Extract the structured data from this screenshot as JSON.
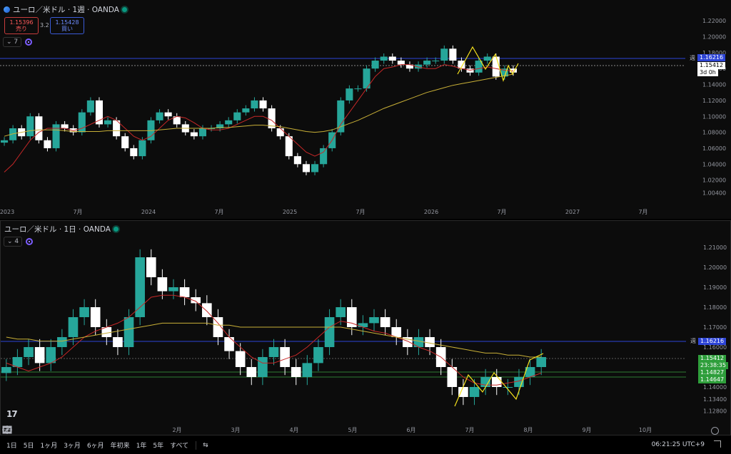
{
  "top_chart": {
    "title": "ユーロ／米ドル · 1週 · OANDA",
    "sell_price": "1.15396",
    "sell_label": "売り",
    "spread": "3.2",
    "buy_price": "1.15428",
    "buy_label": "買い",
    "indicator_count": "7",
    "y_ticks": [
      "1.22000",
      "1.20000",
      "1.18000",
      "1.16000",
      "1.14000",
      "1.12000",
      "1.10000",
      "1.08000",
      "1.06000",
      "1.04000",
      "1.02000",
      "1.00400"
    ],
    "x_ticks": [
      "2023",
      "7月",
      "2024",
      "7月",
      "2025",
      "7月",
      "2026",
      "7月",
      "2027",
      "7月"
    ],
    "line_label": "週",
    "line_price": "1.16216",
    "current_price": "1.15412",
    "countdown": "3d 0h"
  },
  "bottom_chart": {
    "title": "ユーロ／米ドル · 1日 · OANDA",
    "indicator_count": "4",
    "y_ticks": [
      "1.21000",
      "1.20000",
      "1.19000",
      "1.18000",
      "1.17000",
      "1.16000",
      "1.15000",
      "1.14000",
      "1.13400",
      "1.12800"
    ],
    "x_ticks": [
      "2月",
      "3月",
      "4月",
      "5月",
      "6月",
      "7月",
      "8月",
      "9月",
      "10月"
    ],
    "line_label": "週",
    "line_price": "1.16216",
    "current_price": "1.15412",
    "countdown": "23:38:35",
    "support_1": "1.14827",
    "support_2": "1.14647"
  },
  "toolbar": {
    "timeframes": [
      "1日",
      "5日",
      "1ヶ月",
      "3ヶ月",
      "6ヶ月",
      "年初来",
      "1年",
      "5年",
      "すべて"
    ],
    "clock": "06:21:25 UTC+9",
    "logo": "17"
  },
  "colors": {
    "up": "#26a69a",
    "down": "#ffffff",
    "ma_red": "#c62828",
    "ma_yellow": "#c9b037",
    "pattern": "#f5e11c",
    "blue_line": "#2d44d6",
    "green_line": "#2e7d32"
  },
  "chart_data": [
    {
      "type": "candlestick",
      "title": "ユーロ／米ドル · 1週 · OANDA",
      "x": [
        "2023",
        "7月",
        "2024",
        "7月",
        "2025",
        "7月",
        "2026",
        "7月",
        "2027",
        "7月"
      ],
      "ylim": [
        1.0,
        1.23
      ],
      "series": [
        {
          "values": [
            1.07,
            1.085,
            1.075,
            1.1,
            1.07,
            1.06,
            1.09,
            1.085,
            1.08,
            1.105,
            1.12,
            1.09,
            1.095,
            1.075,
            1.06,
            1.05,
            1.07,
            1.095,
            1.105,
            1.1,
            1.09,
            1.08,
            1.075,
            1.085,
            1.085,
            1.09,
            1.095,
            1.105,
            1.11,
            1.12,
            1.11,
            1.085,
            1.075,
            1.05,
            1.04,
            1.03,
            1.04,
            1.06,
            1.08,
            1.12,
            1.135,
            1.135,
            1.16,
            1.17,
            1.175,
            1.17,
            1.165,
            1.16,
            1.165,
            1.17,
            1.17,
            1.185,
            1.17,
            1.16,
            1.155,
            1.17,
            1.175,
            1.15,
            1.16,
            1.155
          ]
        },
        {
          "values": [
            1.03,
            1.04,
            1.055,
            1.07,
            1.08,
            1.085,
            1.085,
            1.085,
            1.082,
            1.085,
            1.09,
            1.095,
            1.1,
            1.095,
            1.085,
            1.075,
            1.07,
            1.075,
            1.085,
            1.095,
            1.1,
            1.098,
            1.092,
            1.085,
            1.083,
            1.083,
            1.085,
            1.09,
            1.095,
            1.1,
            1.1,
            1.095,
            1.085,
            1.075,
            1.065,
            1.055,
            1.05,
            1.055,
            1.07,
            1.09,
            1.105,
            1.12,
            1.135,
            1.15,
            1.16,
            1.162,
            1.165,
            1.165,
            1.162,
            1.16,
            1.16,
            1.165,
            1.163,
            1.16,
            1.158,
            1.16,
            1.162,
            1.16,
            1.158,
            1.157
          ]
        },
        {
          "values": [
            1.075,
            1.078,
            1.08,
            1.082,
            1.083,
            1.083,
            1.083,
            1.082,
            1.081,
            1.081,
            1.081,
            1.081,
            1.082,
            1.082,
            1.082,
            1.082,
            1.082,
            1.082,
            1.083,
            1.084,
            1.085,
            1.085,
            1.085,
            1.085,
            1.085,
            1.086,
            1.086,
            1.087,
            1.088,
            1.089,
            1.089,
            1.088,
            1.087,
            1.085,
            1.083,
            1.081,
            1.08,
            1.081,
            1.083,
            1.087,
            1.091,
            1.095,
            1.1,
            1.105,
            1.11,
            1.114,
            1.118,
            1.122,
            1.126,
            1.13,
            1.133,
            1.136,
            1.139,
            1.141,
            1.143,
            1.145,
            1.147,
            1.149,
            1.151,
            1.153
          ]
        }
      ]
    },
    {
      "type": "candlestick",
      "title": "ユーロ／米ドル · 1日 · OANDA",
      "x": [
        "2月",
        "3月",
        "4月",
        "5月",
        "6月",
        "7月",
        "8月",
        "9月",
        "10月"
      ],
      "ylim": [
        1.125,
        1.215
      ],
      "series": [
        {
          "values": [
            1.15,
            1.155,
            1.16,
            1.152,
            1.16,
            1.165,
            1.175,
            1.18,
            1.17,
            1.165,
            1.16,
            1.175,
            1.205,
            1.195,
            1.188,
            1.19,
            1.185,
            1.182,
            1.175,
            1.165,
            1.158,
            1.15,
            1.145,
            1.155,
            1.16,
            1.15,
            1.145,
            1.152,
            1.16,
            1.175,
            1.18,
            1.17,
            1.172,
            1.175,
            1.17,
            1.165,
            1.16,
            1.165,
            1.16,
            1.15,
            1.14,
            1.135,
            1.14,
            1.145,
            1.14,
            1.14,
            1.145,
            1.15,
            1.155
          ]
        },
        {
          "values": [
            1.152,
            1.15,
            1.148,
            1.15,
            1.152,
            1.155,
            1.16,
            1.165,
            1.168,
            1.17,
            1.172,
            1.175,
            1.18,
            1.185,
            1.186,
            1.186,
            1.185,
            1.183,
            1.178,
            1.172,
            1.165,
            1.16,
            1.155,
            1.152,
            1.152,
            1.154,
            1.156,
            1.16,
            1.165,
            1.17,
            1.173,
            1.172,
            1.17,
            1.168,
            1.167,
            1.165,
            1.163,
            1.16,
            1.158,
            1.155,
            1.15,
            1.145,
            1.142,
            1.141,
            1.141,
            1.142,
            1.143,
            1.145,
            1.147
          ]
        },
        {
          "values": [
            1.165,
            1.164,
            1.164,
            1.163,
            1.163,
            1.163,
            1.164,
            1.165,
            1.166,
            1.167,
            1.168,
            1.169,
            1.17,
            1.171,
            1.172,
            1.172,
            1.172,
            1.172,
            1.172,
            1.171,
            1.171,
            1.17,
            1.17,
            1.17,
            1.17,
            1.17,
            1.17,
            1.17,
            1.17,
            1.17,
            1.17,
            1.169,
            1.168,
            1.167,
            1.166,
            1.165,
            1.164,
            1.163,
            1.162,
            1.161,
            1.16,
            1.159,
            1.158,
            1.157,
            1.157,
            1.156,
            1.156,
            1.155,
            1.155
          ]
        }
      ]
    }
  ]
}
